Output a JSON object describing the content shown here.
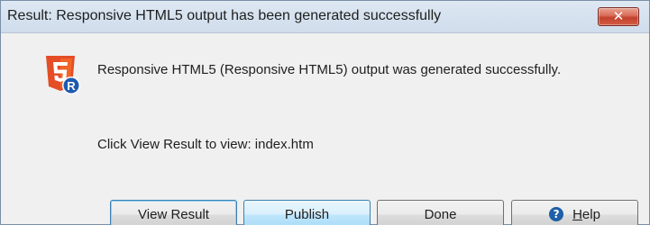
{
  "window": {
    "title": "Result: Responsive HTML5 output has been generated successfully",
    "close_glyph": "✕"
  },
  "icon": {
    "name": "responsive-html5-icon",
    "badge_letter": "R",
    "colors": {
      "shield": "#e44d26",
      "shield_light": "#f16529",
      "badge": "#1e5bb0"
    }
  },
  "content": {
    "message": "Responsive HTML5 (Responsive HTML5) output was generated successfully.",
    "view_info": "Click View Result to view: index.htm"
  },
  "buttons": {
    "view_result": "View Result",
    "publish": "Publish",
    "done": "Done",
    "help_prefix": "",
    "help_mnemonic": "H",
    "help_rest": "elp"
  }
}
